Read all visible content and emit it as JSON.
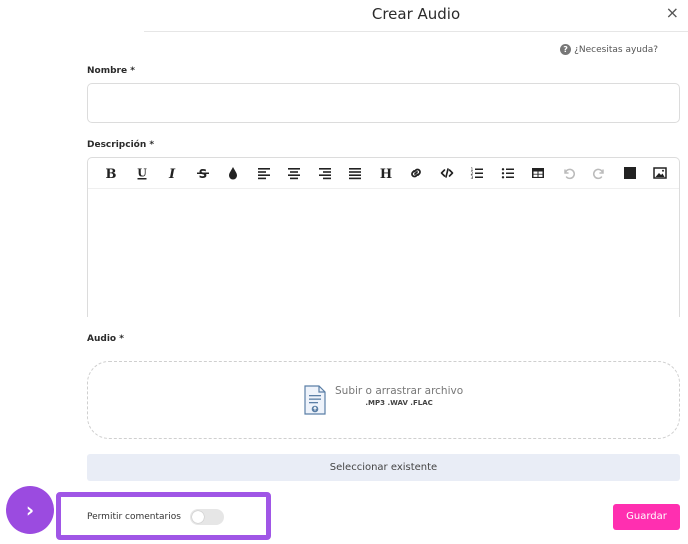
{
  "modal": {
    "title": "Crear Audio",
    "close_icon": "×",
    "help_text": "¿Necesitas ayuda?"
  },
  "fields": {
    "name_label": "Nombre *",
    "name_value": "",
    "description_label": "Descripción *",
    "audio_label": "Audio *"
  },
  "editor": {
    "toolbar": [
      "bold-icon",
      "underline-icon",
      "italic-icon",
      "strikethrough-icon",
      "color-drop-icon",
      "align-left-icon",
      "align-center-icon",
      "align-right-icon",
      "align-justify-icon",
      "heading-icon",
      "link-icon",
      "code-icon",
      "ordered-list-icon",
      "unordered-list-icon",
      "table-icon",
      "undo-icon",
      "redo-icon",
      "color-square-icon",
      "image-icon"
    ]
  },
  "upload": {
    "main_text": "Subir o arrastrar archivo",
    "formats": ".MP3 .WAV .FLAC",
    "select_existing": "Seleccionar existente"
  },
  "footer": {
    "allow_comments_label": "Permitir comentarios",
    "allow_comments_on": false,
    "save_label": "Guardar",
    "fab_glyph": "›"
  },
  "colors": {
    "accent_purple": "#9b4be0",
    "save_pink": "#ff2fb0"
  }
}
